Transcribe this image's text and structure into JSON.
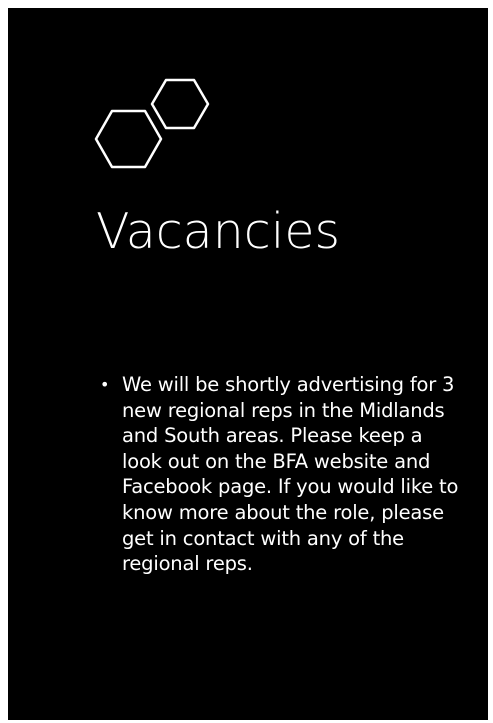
{
  "slide": {
    "title": "Vacancies",
    "bullets": [
      "We will be shortly advertising for 3 new regional reps in the Midlands and South areas. Please keep a look out on the BFA website and Facebook page.  If you would like to know more about the role, please get in contact with any of the regional reps."
    ],
    "bullet_glyph": "•",
    "logo_icon": "hexagon-pair-icon"
  },
  "colors": {
    "background": "#000000",
    "text": "#ffffff",
    "icon_stroke": "#ffffff"
  }
}
